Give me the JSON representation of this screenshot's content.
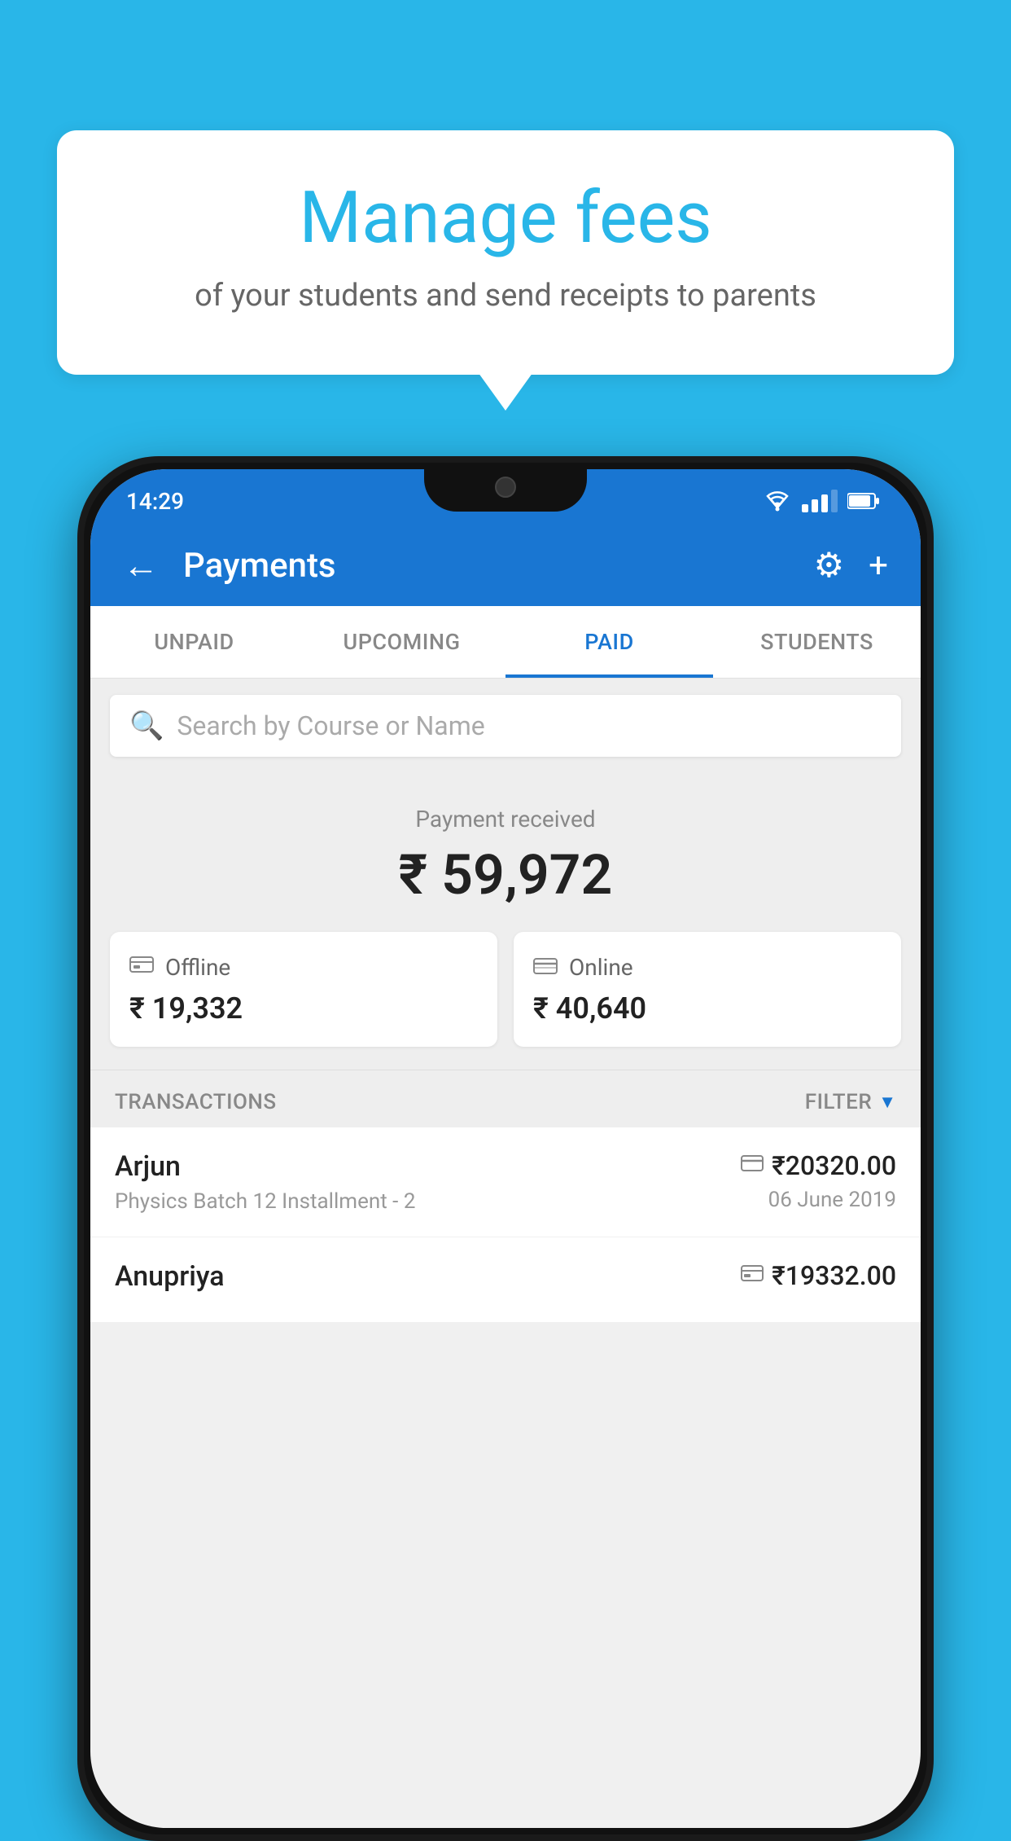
{
  "bubble": {
    "title": "Manage fees",
    "subtitle": "of your students and send receipts to parents"
  },
  "status_bar": {
    "time": "14:29"
  },
  "app_bar": {
    "title": "Payments"
  },
  "tabs": [
    {
      "label": "UNPAID",
      "active": false
    },
    {
      "label": "UPCOMING",
      "active": false
    },
    {
      "label": "PAID",
      "active": true
    },
    {
      "label": "STUDENTS",
      "active": false
    }
  ],
  "search": {
    "placeholder": "Search by Course or Name"
  },
  "payment_summary": {
    "label": "Payment received",
    "amount": "₹ 59,972"
  },
  "payment_cards": [
    {
      "icon": "₹",
      "type": "Offline",
      "amount": "₹ 19,332"
    },
    {
      "icon": "💳",
      "type": "Online",
      "amount": "₹ 40,640"
    }
  ],
  "transactions_section": {
    "label": "TRANSACTIONS",
    "filter_label": "FILTER"
  },
  "transactions": [
    {
      "name": "Arjun",
      "detail": "Physics Batch 12 Installment - 2",
      "mode": "online",
      "amount": "₹20320.00",
      "date": "06 June 2019"
    },
    {
      "name": "Anupriya",
      "detail": "",
      "mode": "offline",
      "amount": "₹19332.00",
      "date": ""
    }
  ]
}
